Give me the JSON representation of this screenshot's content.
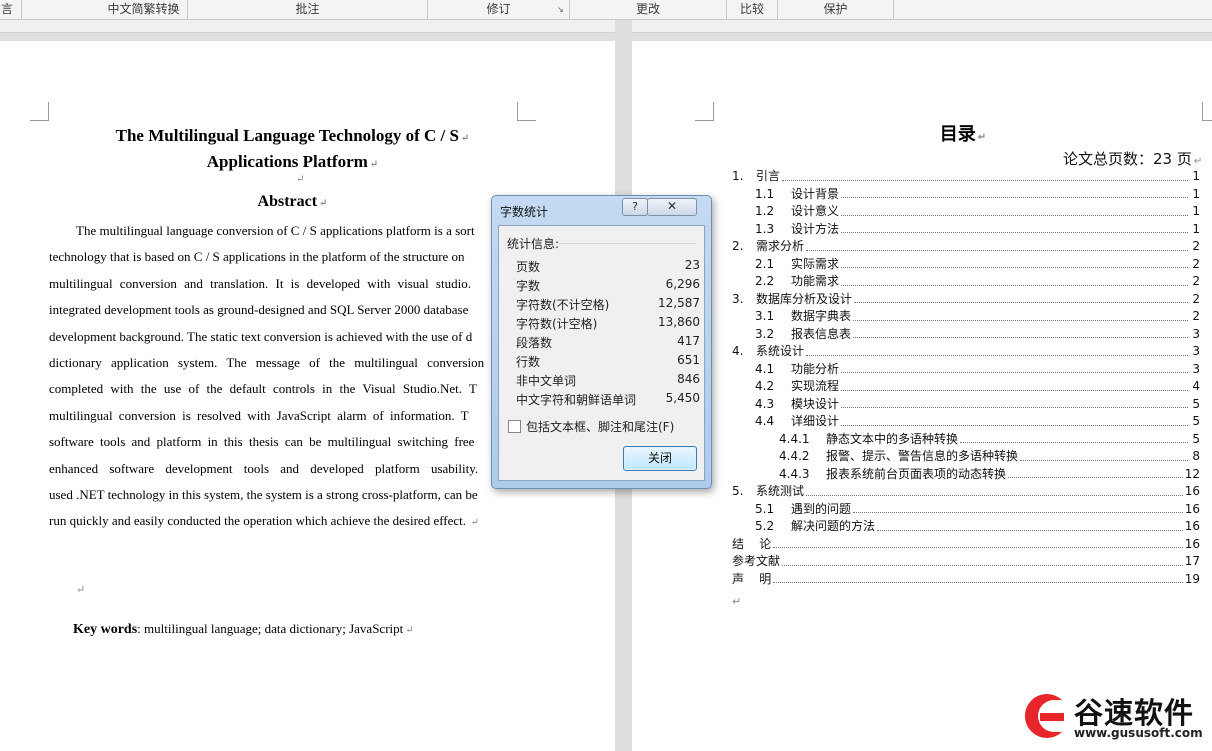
{
  "ribbon": {
    "groups": [
      "言",
      "中文简繁转换",
      "批注",
      "修订",
      "更改",
      "比较",
      "保护"
    ]
  },
  "left_page": {
    "title_line1": "The Multilingual Language Technology of C / S",
    "title_line2": "Applications Platform",
    "abstract_heading": "Abstract",
    "abstract_lines": [
      "The multilingual language conversion of C / S applications platform is a sort",
      "technology that is based on C / S applications in the platform of the structure on",
      "multilingual conversion and translation. It is developed with visual studio.",
      "integrated development tools as ground-designed and SQL Server 2000 database",
      "development background. The static text conversion is achieved with the use of d",
      "dictionary application system. The message of the multilingual conversion",
      "completed with the use of the default controls in the Visual Studio.Net. T",
      "multilingual conversion is resolved with JavaScript alarm of information. T",
      "software tools and platform in this thesis can be multilingual switching free",
      "enhanced software development tools and developed platform usability.",
      "used .NET technology in this system, the system is a strong cross-platform, can be",
      "run quickly and easily conducted the operation which achieve the desired effect."
    ],
    "keywords_label": "Key words",
    "keywords_text": ": multilingual language; data dictionary; JavaScript"
  },
  "right_page": {
    "toc_title": "目录",
    "total_pages": "论文总页数：23 页",
    "toc": [
      {
        "level": 1,
        "num": "1.",
        "text": "引言",
        "page": "1"
      },
      {
        "level": 2,
        "num": "1.1",
        "text": "设计背景",
        "page": "1"
      },
      {
        "level": 2,
        "num": "1.2",
        "text": "设计意义",
        "page": "1"
      },
      {
        "level": 2,
        "num": "1.3",
        "text": "设计方法",
        "page": "1"
      },
      {
        "level": 1,
        "num": "2.",
        "text": "需求分析",
        "page": "2"
      },
      {
        "level": 2,
        "num": "2.1",
        "text": "实际需求",
        "page": "2"
      },
      {
        "level": 2,
        "num": "2.2",
        "text": "功能需求",
        "page": "2"
      },
      {
        "level": 1,
        "num": "3.",
        "text": "数据库分析及设计",
        "page": "2"
      },
      {
        "level": 2,
        "num": "3.1",
        "text": "数据字典表",
        "page": "2"
      },
      {
        "level": 2,
        "num": "3.2",
        "text": "报表信息表",
        "page": "3"
      },
      {
        "level": 1,
        "num": "4.",
        "text": "系统设计",
        "page": "3"
      },
      {
        "level": 2,
        "num": "4.1",
        "text": "功能分析",
        "page": "3"
      },
      {
        "level": 2,
        "num": "4.2",
        "text": "实现流程",
        "page": "4"
      },
      {
        "level": 2,
        "num": "4.3",
        "text": "模块设计",
        "page": "5"
      },
      {
        "level": 2,
        "num": "4.4",
        "text": "详细设计",
        "page": "5"
      },
      {
        "level": 3,
        "num": "4.4.1",
        "text": "静态文本中的多语种转换",
        "page": "5"
      },
      {
        "level": 3,
        "num": "4.4.2",
        "text": "报警、提示、警告信息的多语种转换",
        "page": "8"
      },
      {
        "level": 3,
        "num": "4.4.3",
        "text": "报表系统前台页面表项的动态转换",
        "page": "12"
      },
      {
        "level": 1,
        "num": "5.",
        "text": "系统测试",
        "page": "16"
      },
      {
        "level": 2,
        "num": "5.1",
        "text": "遇到的问题",
        "page": "16"
      },
      {
        "level": 2,
        "num": "5.2",
        "text": "解决问题的方法",
        "page": "16"
      },
      {
        "level": 0,
        "num": "",
        "text": "结    论",
        "page": "16"
      },
      {
        "level": 0,
        "num": "",
        "text": "参考文献",
        "page": "17"
      },
      {
        "level": 0,
        "num": "",
        "text": "声    明",
        "page": "19"
      }
    ]
  },
  "dialog": {
    "title": "字数统计",
    "help": "?",
    "close": "✕",
    "stats_label": "统计信息:",
    "stats": [
      {
        "label": "页数",
        "value": "23"
      },
      {
        "label": "字数",
        "value": "6,296"
      },
      {
        "label": "字符数(不计空格)",
        "value": "12,587"
      },
      {
        "label": "字符数(计空格)",
        "value": "13,860"
      },
      {
        "label": "段落数",
        "value": "417"
      },
      {
        "label": "行数",
        "value": "651"
      },
      {
        "label": "非中文单词",
        "value": "846"
      },
      {
        "label": "中文字符和朝鲜语单词",
        "value": "5,450"
      }
    ],
    "checkbox_label": "包括文本框、脚注和尾注(F)",
    "close_button": "关闭"
  },
  "logo": {
    "text": "谷速软件",
    "url": "www.gususoft.com",
    "color": "#e8252a"
  },
  "colors": {
    "page_bg": "#ffffff",
    "workspace": "#dedede",
    "dialog_frame": "#aecbeb"
  }
}
